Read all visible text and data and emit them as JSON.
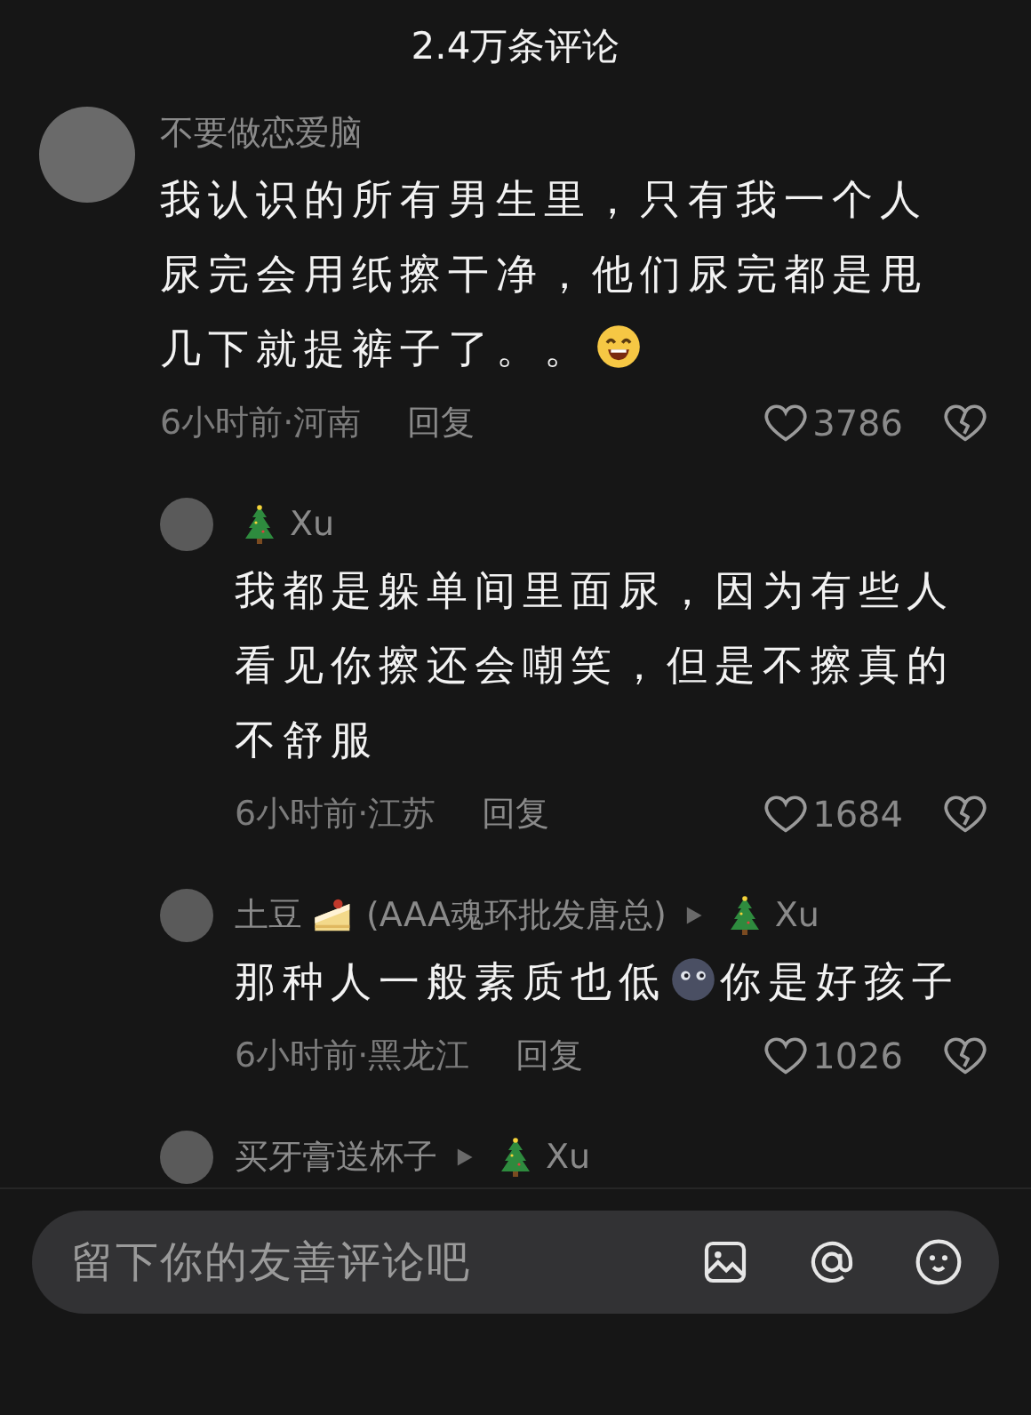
{
  "header": {
    "title": "2.4万条评论"
  },
  "comments": [
    {
      "author": [
        {
          "kind": "text",
          "text": "不要做恋爱脑"
        }
      ],
      "body": [
        {
          "kind": "text",
          "text": "我认识的所有男生里，只有我一个人尿完会用纸擦干净，他们尿完都是甩"
        },
        {
          "kind": "text",
          "text": "几下就提裤子了。。"
        },
        {
          "kind": "grin"
        }
      ],
      "meta": "6小时前·河南",
      "reply_label": "回复",
      "likes": "3786",
      "children": [
        {
          "author": [
            {
              "kind": "tree"
            },
            {
              "kind": "text",
              "text": "Xu"
            }
          ],
          "body": [
            {
              "kind": "text",
              "text": "我都是躲单间里面尿，因为有些人看见你擦还会嘲笑，但是不擦真的不舒服"
            }
          ],
          "meta": "6小时前·江苏",
          "reply_label": "回复",
          "likes": "1684"
        },
        {
          "author": [
            {
              "kind": "text",
              "text": "土豆"
            },
            {
              "kind": "cake"
            },
            {
              "kind": "text",
              "text": "(AAA魂环批发唐总)"
            }
          ],
          "reply_to": [
            {
              "kind": "tree"
            },
            {
              "kind": "text",
              "text": "Xu"
            }
          ],
          "body": [
            {
              "kind": "text",
              "text": "那种人一般素质也低"
            },
            {
              "kind": "moon"
            },
            {
              "kind": "text",
              "text": "你是好孩子"
            }
          ],
          "meta": "6小时前·黑龙江",
          "reply_label": "回复",
          "likes": "1026"
        },
        {
          "author": [
            {
              "kind": "text",
              "text": "买牙膏送杯子"
            }
          ],
          "reply_to": [
            {
              "kind": "tree"
            },
            {
              "kind": "text",
              "text": "Xu"
            }
          ]
        }
      ]
    }
  ],
  "composer": {
    "placeholder": "留下你的友善评论吧"
  }
}
